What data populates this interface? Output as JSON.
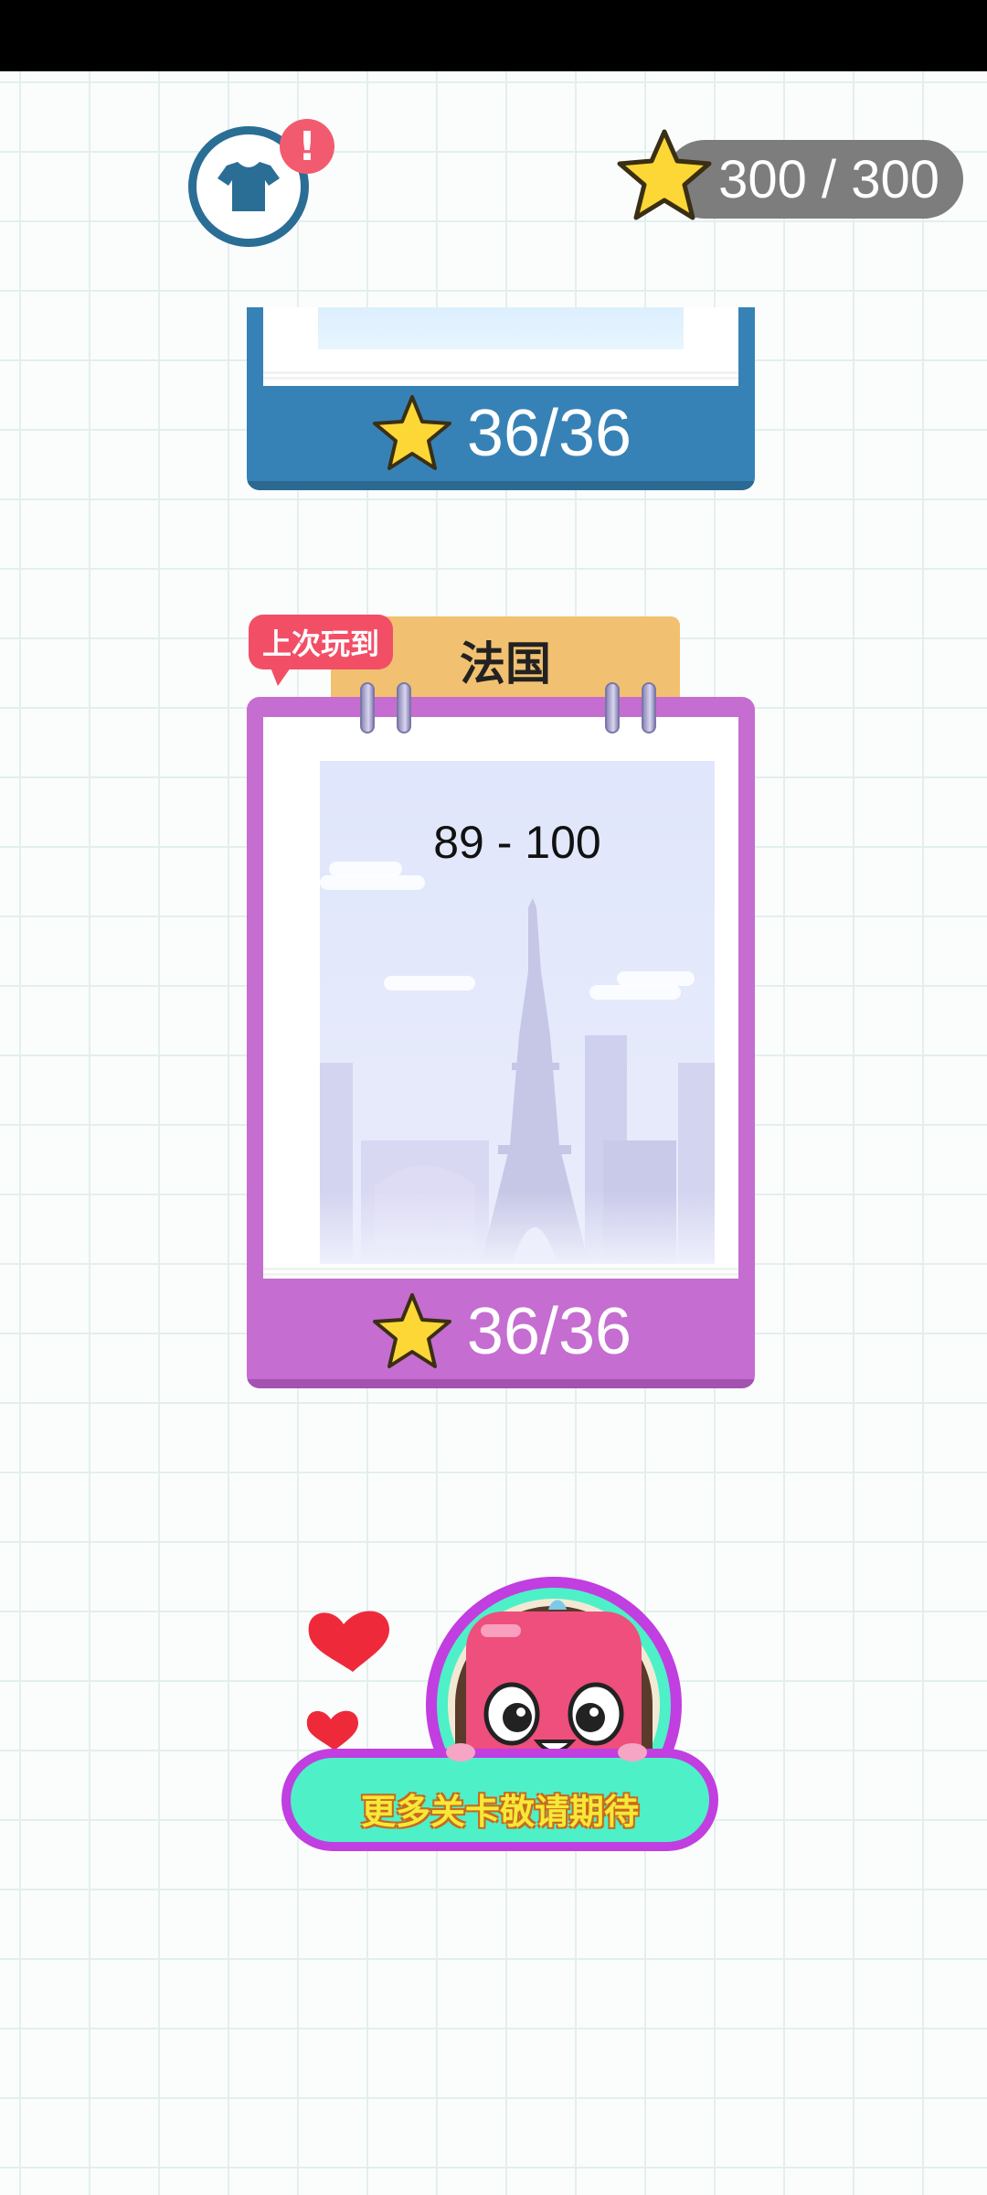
{
  "header": {
    "alert_badge": "!",
    "star_counter": "300 / 300"
  },
  "albums": [
    {
      "score": "36/36",
      "color": "#3682b6"
    },
    {
      "tab_title": "法国",
      "last_played_tag": "上次玩到",
      "level_range": "89 - 100",
      "score": "36/36",
      "color": "#c56dd0"
    }
  ],
  "banner": {
    "text": "更多关卡敬请期待"
  },
  "icons": {
    "wardrobe": "tshirt-icon",
    "alert": "exclamation-icon",
    "star": "star-icon"
  },
  "colors": {
    "accent_blue": "#2a6e96",
    "alert_red": "#f25b6f",
    "star_yellow": "#fcd735",
    "tab_orange": "#f1c171"
  }
}
